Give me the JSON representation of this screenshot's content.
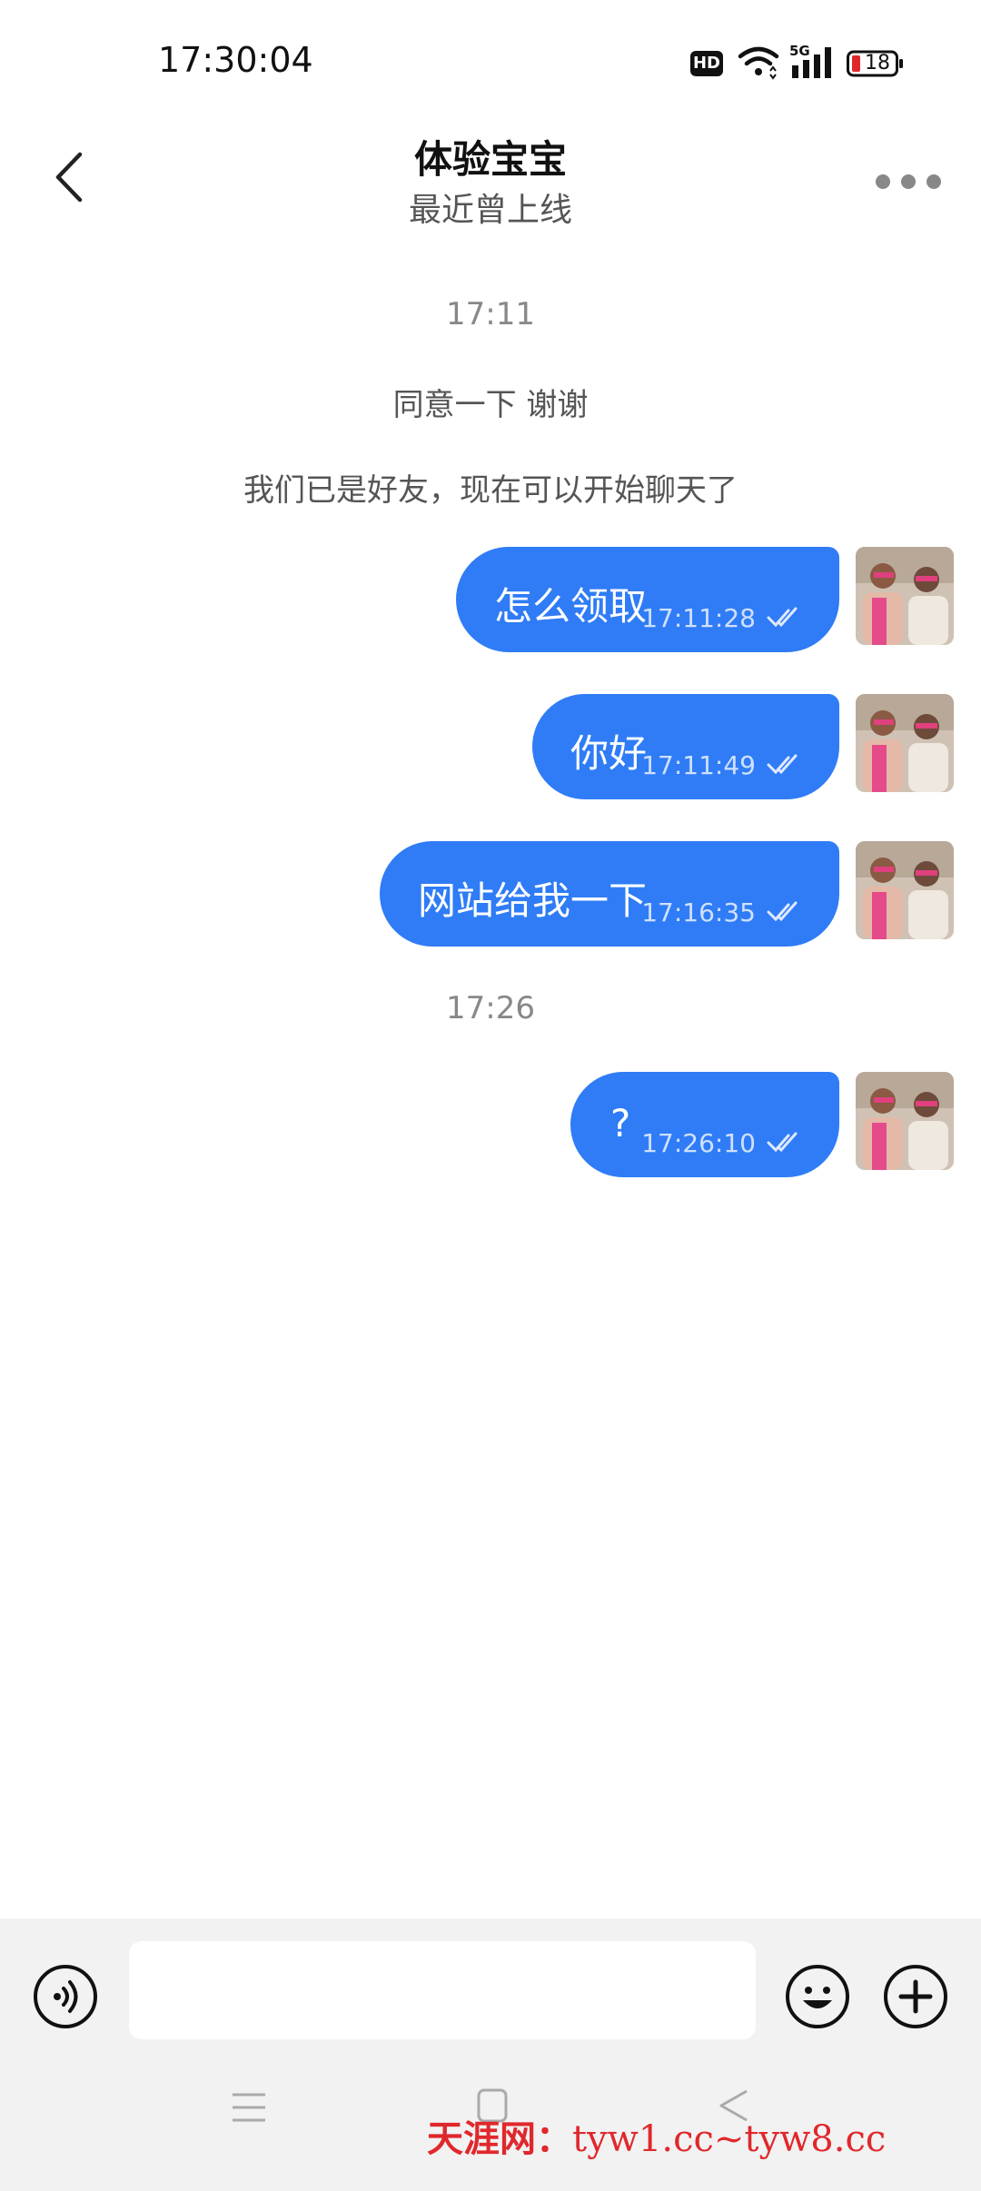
{
  "status_bar": {
    "time": "17:30:04",
    "hd_label": "HD",
    "network_label": "5G",
    "battery_level": "18"
  },
  "header": {
    "title": "体验宝宝",
    "subtitle": "最近曾上线"
  },
  "conversation": {
    "timestamp_1": "17:11",
    "system_1": "同意一下 谢谢",
    "system_2": "我们已是好友，现在可以开始聊天了",
    "messages": [
      {
        "text": "怎么领取",
        "time": "17:11:28"
      },
      {
        "text": "你好",
        "time": "17:11:49"
      },
      {
        "text": "网站给我一下",
        "time": "17:16:35"
      }
    ],
    "timestamp_2": "17:26",
    "messages_2": [
      {
        "text": "?",
        "time": "17:26:10"
      }
    ]
  },
  "input": {
    "value": "",
    "placeholder": ""
  },
  "watermark": {
    "brand": "天涯网：",
    "urls": "tyw1.cc~tyw8.cc"
  },
  "colors": {
    "bubble": "#2f7cf6",
    "input_bar_bg": "#f2f2f2"
  },
  "icons": {
    "back": "chevron-left-icon",
    "more": "more-horizontal-icon",
    "voice": "voice-icon",
    "emoji": "smiley-icon",
    "plus": "plus-circle-icon"
  }
}
